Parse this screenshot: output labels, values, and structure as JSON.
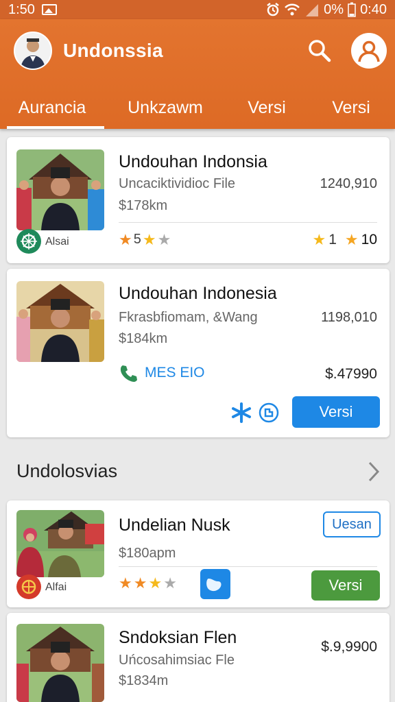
{
  "status_bar": {
    "time": "1:50",
    "battery": "0%",
    "clock": "0:40"
  },
  "app": {
    "title": "Undonssia"
  },
  "tabs": [
    {
      "label": "Aurancia"
    },
    {
      "label": "Unkzawm"
    },
    {
      "label": "Versi"
    },
    {
      "label": "Versi"
    }
  ],
  "cards": [
    {
      "title": "Undouhan Indonsia",
      "subtitle": "Uncaciktividioc File",
      "price": "$178km",
      "number": "1240,910",
      "badge_label": "Alsai",
      "rating_left": "5",
      "rating_right_a": "1",
      "rating_right_b": "10"
    },
    {
      "title": "Undouhan Indonesia",
      "subtitle": "Fkrasbfiomam, &Wang",
      "price": "$184km",
      "number": "1198,010",
      "contact": "MES EIO",
      "amount": "$.47990",
      "button": "Versi"
    },
    {
      "title": "Undelian Nusk",
      "price": "$180apm",
      "outline_button": "Uesan",
      "button": "Versi",
      "badge_label": "Alfai"
    },
    {
      "title": "Sndoksian Flen",
      "subtitle": "Uńcosahimsiac Fle",
      "price": "$1834m",
      "amount": "$.9,9900"
    }
  ],
  "section": {
    "title": "Undolosvias"
  },
  "colors": {
    "primary": "#dd6a25",
    "accent_blue": "#1e88e5",
    "accent_green": "#4c9a3e",
    "star": "#f5a623"
  }
}
